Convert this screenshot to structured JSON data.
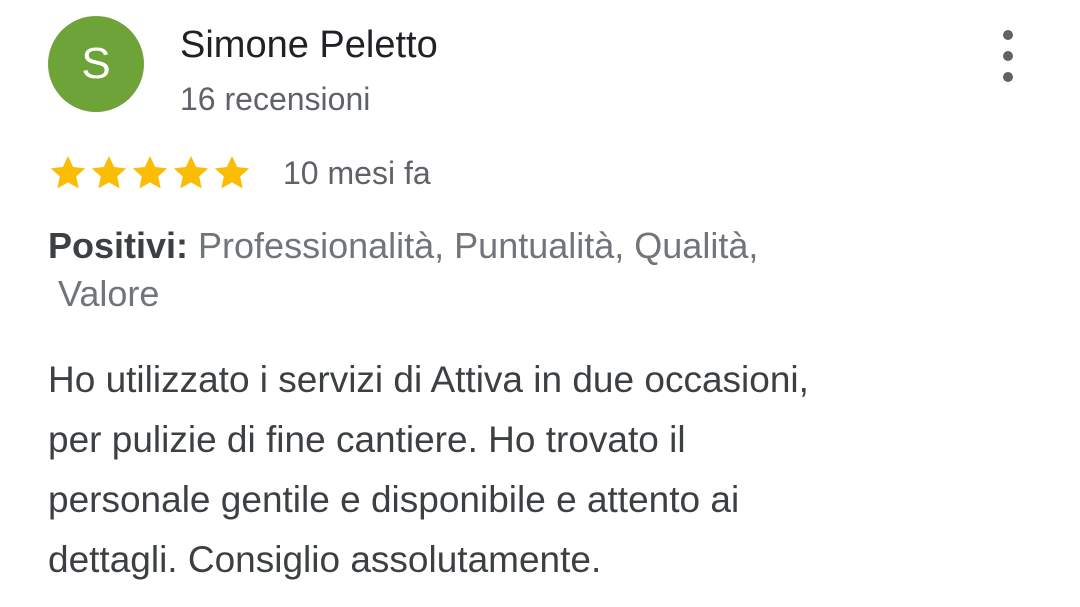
{
  "reviewer": {
    "initial": "S",
    "name": "Simone Peletto",
    "review_count": "16 recensioni",
    "avatar_color": "#6ea33a"
  },
  "menu": {
    "icon": "more-vert-icon"
  },
  "rating": {
    "stars": 5,
    "max_stars": 5,
    "star_color": "#fbbc04",
    "time_ago": "10 mesi fa"
  },
  "highlights": {
    "label": "Positivi:",
    "line1": " Professionalità, Puntualità, Qualità,",
    "line2": "Valore"
  },
  "review": {
    "lines": [
      "Ho utilizzato i servizi di Attiva in due occasioni,",
      "per pulizie di fine cantiere. Ho trovato il",
      "personale gentile e disponibile e attento ai",
      "dettagli. Consiglio assolutamente."
    ]
  }
}
